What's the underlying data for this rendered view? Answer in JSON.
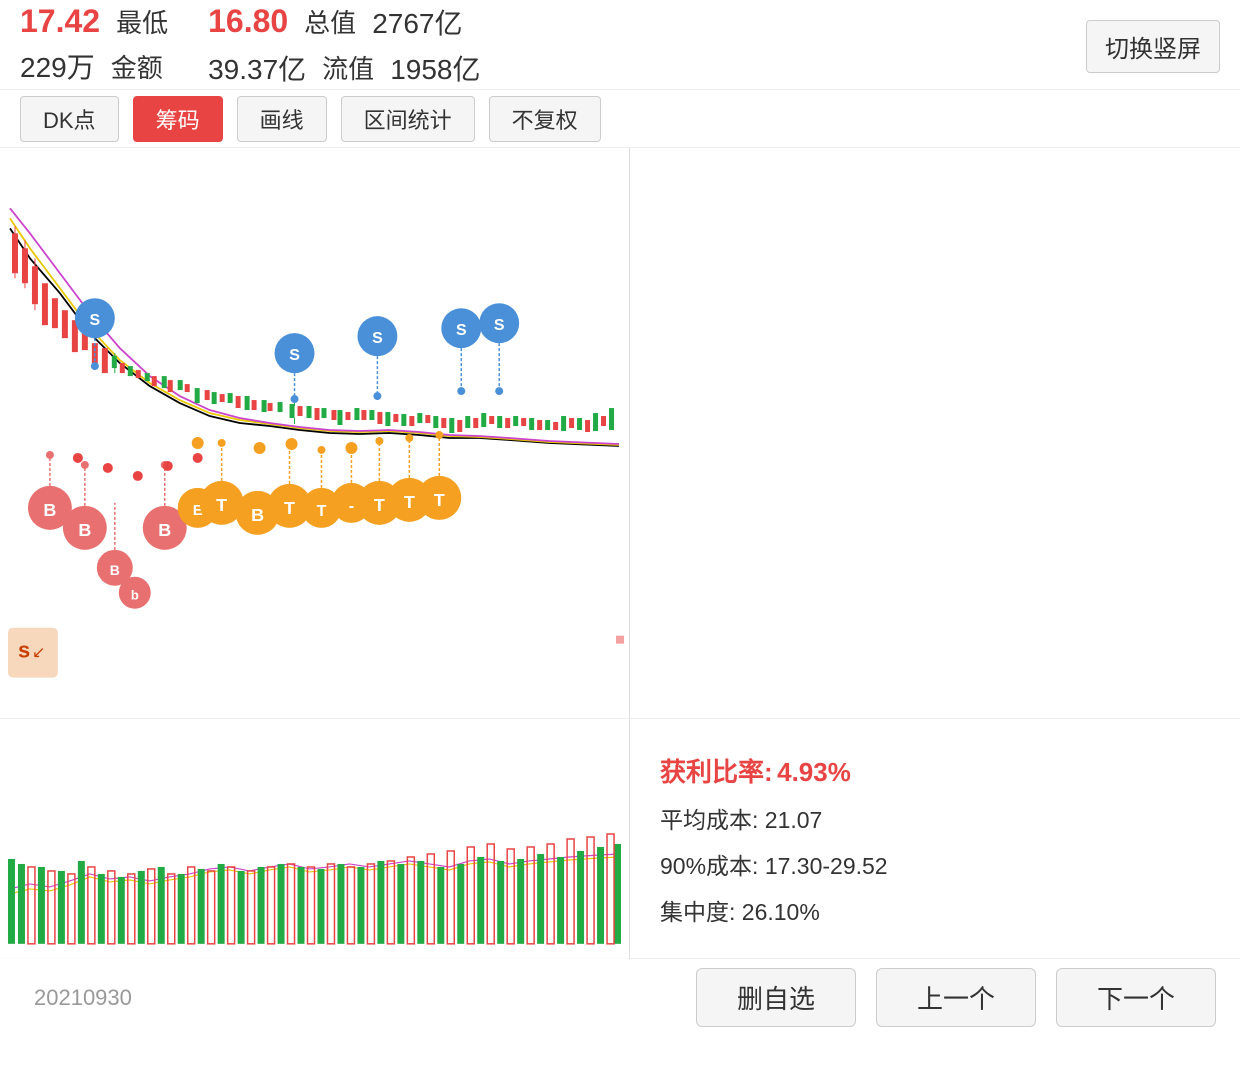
{
  "header": {
    "low_label": "最低",
    "low_value": "17.42",
    "amount_value": "229万",
    "amount_label": "金额",
    "min_value": "16.80",
    "total_label": "总值",
    "total_value": "2767亿",
    "amount2_value": "39.37亿",
    "float_label": "流值",
    "float_value": "1958亿",
    "switch_btn": "切换竖屏"
  },
  "toolbar": {
    "btn1": "DK点",
    "btn2": "筹码",
    "btn3": "画线",
    "btn4": "区间统计",
    "btn5": "不复权"
  },
  "bottom_right": {
    "profit_rate_label": "获利比率:",
    "profit_rate_value": "4.93%",
    "avg_cost_label": "平均成本:",
    "avg_cost_value": "21.07",
    "cost90_label": "90%成本:",
    "cost90_value": "17.30-29.52",
    "concentration_label": "集中度:",
    "concentration_value": "26.10%"
  },
  "footer": {
    "date": "20210930",
    "btn_delete": "删自选",
    "btn_prev": "上一个",
    "btn_next": "下一个"
  }
}
